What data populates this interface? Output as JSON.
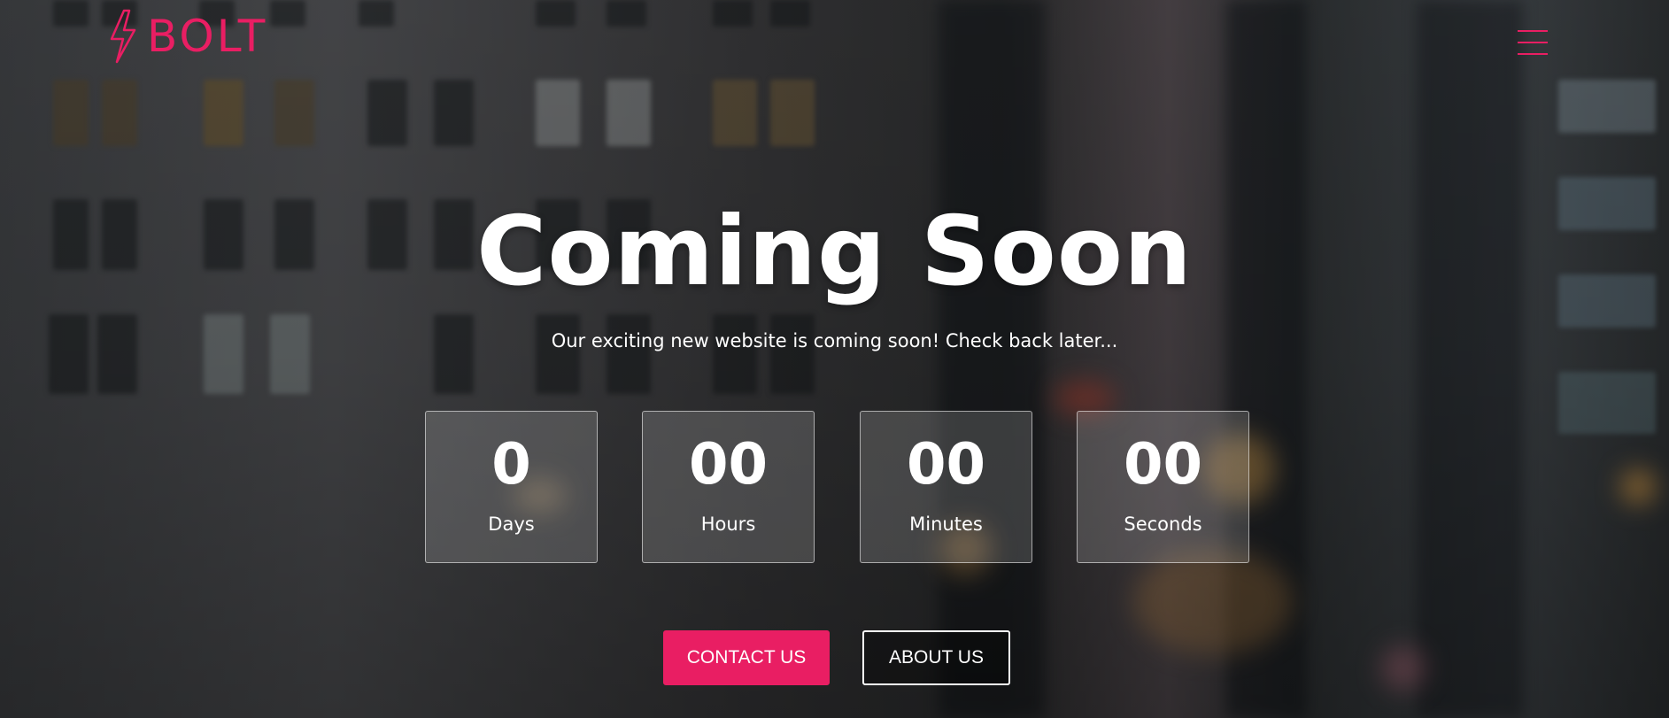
{
  "brand": {
    "name": "BOLT",
    "accent_color": "#e91e63",
    "logo_icon": "lightning-bolt-icon"
  },
  "header": {
    "menu_icon": "hamburger-menu-icon"
  },
  "hero": {
    "title": "Coming Soon",
    "subtitle": "Our exciting new website is coming soon! Check back later..."
  },
  "countdown": [
    {
      "value": "0",
      "label": "Days"
    },
    {
      "value": "00",
      "label": "Hours"
    },
    {
      "value": "00",
      "label": "Minutes"
    },
    {
      "value": "00",
      "label": "Seconds"
    }
  ],
  "actions": {
    "contact_label": "CONTACT US",
    "about_label": "ABOUT US"
  }
}
